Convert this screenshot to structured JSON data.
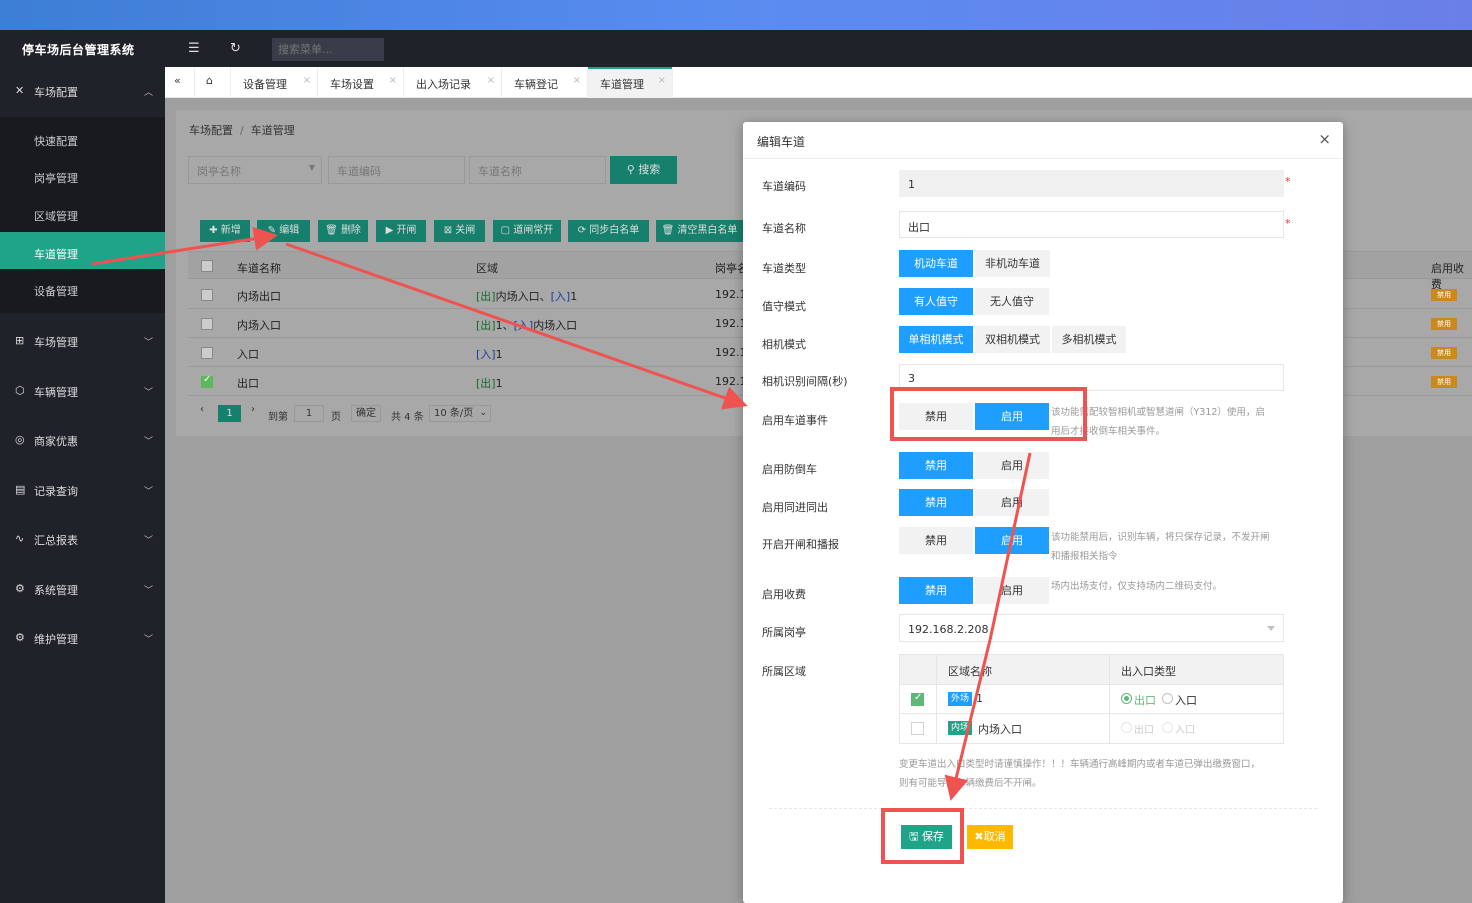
{
  "header": {
    "app_title": "停车场后台管理系统",
    "search_placeholder": "搜索菜单..."
  },
  "sidebar": {
    "groups": [
      {
        "label": "车场配置",
        "icon": "tools-icon",
        "expanded": true
      },
      {
        "label": "车场管理",
        "icon": "grid-icon"
      },
      {
        "label": "车辆管理",
        "icon": "cube-icon"
      },
      {
        "label": "商家优惠",
        "icon": "ticket-icon"
      },
      {
        "label": "记录查询",
        "icon": "doc-icon"
      },
      {
        "label": "汇总报表",
        "icon": "pulse-icon"
      },
      {
        "label": "系统管理",
        "icon": "gear-icon"
      },
      {
        "label": "维护管理",
        "icon": "gear-icon"
      }
    ],
    "sub_items": [
      "快速配置",
      "岗亭管理",
      "区域管理",
      "车道管理",
      "设备管理"
    ],
    "active_sub": "车道管理"
  },
  "tabs": [
    "设备管理",
    "车场设置",
    "出入场记录",
    "车辆登记",
    "车道管理"
  ],
  "breadcrumb": {
    "parent": "车场配置",
    "sep": "/",
    "current": "车道管理"
  },
  "filters": {
    "booth_placeholder": "岗亭名称",
    "code_placeholder": "车道编码",
    "name_placeholder": "车道名称",
    "search_label": "搜索"
  },
  "toolbar": [
    "新增",
    "编辑",
    "删除",
    "开闸",
    "关闸",
    "道闸常开",
    "同步白名单",
    "清空黑白名单"
  ],
  "table": {
    "headers": [
      "车道名称",
      "区域",
      "岗亭名",
      "启用收费"
    ],
    "rows": [
      {
        "name": "内场出口",
        "area_a": "[出]",
        "area_b": "内场入口、",
        "area_c": "[入]",
        "area_d": "1",
        "ip": "192.16",
        "charge": "禁用",
        "checked": false
      },
      {
        "name": "内场入口",
        "area_a": "[出]",
        "area_b": "1、",
        "area_c": "[入]",
        "area_d": "内场入口",
        "ip": "192.16",
        "charge": "禁用",
        "checked": false
      },
      {
        "name": "入口",
        "area_a": "",
        "area_b": "",
        "area_c": "[入]",
        "area_d": "1",
        "ip": "192.16",
        "charge": "禁用",
        "checked": false
      },
      {
        "name": "出口",
        "area_a": "[出]",
        "area_b": "1",
        "area_c": "",
        "area_d": "",
        "ip": "192.16",
        "charge": "禁用",
        "checked": true
      }
    ]
  },
  "pager": {
    "current": "1",
    "goto_label": "到第",
    "goto_value": "1",
    "page_unit": "页",
    "confirm": "确定",
    "total": "共 4 条",
    "page_size": "10 条/页"
  },
  "modal": {
    "title": "编辑车道",
    "close": "×",
    "fields": {
      "code": {
        "label": "车道编码",
        "value": "1"
      },
      "name": {
        "label": "车道名称",
        "value": "出口"
      },
      "lane_type": {
        "label": "车道类型",
        "options": [
          "机动车道",
          "非机动车道"
        ],
        "selected": 0
      },
      "duty": {
        "label": "值守模式",
        "options": [
          "有人值守",
          "无人值守"
        ],
        "selected": 0
      },
      "camera": {
        "label": "相机模式",
        "options": [
          "单相机模式",
          "双相机模式",
          "多相机模式"
        ],
        "selected": 0
      },
      "interval": {
        "label": "相机识别间隔(秒)",
        "value": "3"
      },
      "lane_event": {
        "label": "启用车道事件",
        "options": [
          "禁用",
          "启用"
        ],
        "selected": 1,
        "hint1": "该功能需配较智相机或智慧道闸（Y312）使用，启",
        "hint2": "用后才接收倒车相关事件。"
      },
      "anti_reverse": {
        "label": "启用防倒车",
        "options": [
          "禁用",
          "启用"
        ],
        "selected": 0
      },
      "same_in_out": {
        "label": "启用同进同出",
        "options": [
          "禁用",
          "启用"
        ],
        "selected": 0
      },
      "open_gate": {
        "label": "开启开闸和播报",
        "options": [
          "禁用",
          "启用"
        ],
        "selected": 1,
        "hint1": "该功能禁用后，识别车辆，将只保存记录，不发开闸",
        "hint2": "和播报相关指令"
      },
      "charge": {
        "label": "启用收费",
        "options": [
          "禁用",
          "启用"
        ],
        "selected": 0,
        "hint1": "场内出场支付，仅支持场内二维码支付。"
      },
      "booth": {
        "label": "所属岗亭",
        "value": "192.168.2.208"
      },
      "area": {
        "label": "所属区域",
        "col_name": "区域名称",
        "col_type": "出入口类型",
        "rows": [
          {
            "tag": "外场",
            "tag_color": "#1e9fff",
            "name": "1",
            "checked": true,
            "out": "出口",
            "in": "入口",
            "sel": "out"
          },
          {
            "tag": "内场",
            "tag_color": "#1fa48a",
            "name": "内场入口",
            "checked": false,
            "out": "出口",
            "in": "入口",
            "sel": "none"
          }
        ]
      }
    },
    "warning1": "变更车道出入口类型时请谨慎操作！！！车辆通行高峰期内或者车道已弹出缴费窗口，",
    "warning2": "则有可能导致车辆缴费后不开闸。",
    "save": "保存",
    "cancel": "取消"
  },
  "colors": {
    "accent": "#1fa48a",
    "primary": "#1e9fff",
    "warn": "#ffb800",
    "annotation": "#ef5350"
  }
}
